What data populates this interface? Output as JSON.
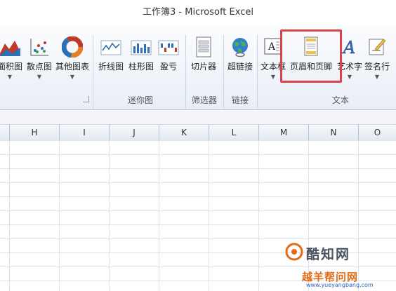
{
  "window": {
    "title": "工作簿3 - Microsoft Excel"
  },
  "ribbon": {
    "buttons": [
      {
        "label": "面积图",
        "icon": "area-chart-icon"
      },
      {
        "label": "散点图",
        "icon": "scatter-chart-icon"
      },
      {
        "label": "其他图表",
        "icon": "donut-chart-icon"
      },
      {
        "label": "折线图",
        "icon": "sparkline-line-icon"
      },
      {
        "label": "柱形图",
        "icon": "sparkline-column-icon"
      },
      {
        "label": "盈亏",
        "icon": "sparkline-winloss-icon"
      },
      {
        "label": "切片器",
        "icon": "slicer-icon"
      },
      {
        "label": "超链接",
        "icon": "hyperlink-globe-icon"
      },
      {
        "label": "文本框",
        "icon": "textbox-icon"
      },
      {
        "label": "页眉和页脚",
        "icon": "header-footer-icon"
      },
      {
        "label": "艺术字",
        "icon": "wordart-icon"
      },
      {
        "label": "签名行",
        "icon": "signature-line-icon"
      }
    ],
    "groups": {
      "sparklines": "迷你图",
      "filter": "筛选器",
      "links": "链接",
      "text": "文本"
    }
  },
  "grid": {
    "columns": [
      "H",
      "I",
      "J",
      "K",
      "L",
      "M",
      "N",
      "O"
    ]
  },
  "watermark": {
    "main": "酷知网",
    "sub": "越羊帮问网",
    "url": "www.yueyangbang.com"
  },
  "colors": {
    "highlight": "#d9434a",
    "ribbon_bg": "#e9eef6"
  }
}
